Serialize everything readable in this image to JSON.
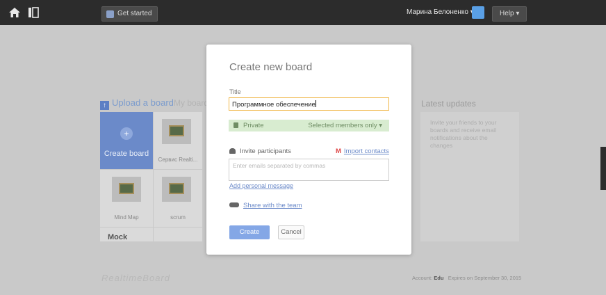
{
  "topbar": {
    "get_started": "Get started",
    "user_name": "Марина Белоненко ▾",
    "help": "Help ▾",
    "icons": [
      "home-icon",
      "layout-toggle-icon",
      "check-icon",
      "avatar"
    ]
  },
  "dashboard": {
    "upload_label": "Upload a board",
    "my_boards_label": "My board",
    "create_board": "Create board",
    "boards": [
      {
        "caption": "Сервис Realti..."
      },
      {
        "caption": "Mind Map"
      },
      {
        "caption": "scrum"
      }
    ],
    "mock_label": "Mock",
    "latest_title": "Latest updates",
    "latest_text": "Invite your friends to your boards and receive email notifications about the changes"
  },
  "footer": {
    "logo": "RealtimeBoard",
    "account_prefix": "Account:",
    "account_name": "Edu",
    "expires": "Expires on September 30, 2015"
  },
  "modal": {
    "title": "Create new board",
    "title_label": "Title",
    "title_value": "Программное обеспечение",
    "privacy": "Private",
    "privacy_option": "Selected members only ▾",
    "invite_label": "Invite participants",
    "import_contacts": "Import contacts",
    "emails_placeholder": "Enter emails separated by commas",
    "add_message": "Add personal message",
    "share_team": "Share with the team",
    "create_btn": "Create",
    "cancel_btn": "Cancel"
  },
  "colors": {
    "topbar": "#2c2c2c",
    "accent": "#6b8ac9",
    "input_focus": "#f0b544",
    "private_bg": "#d8ecd0"
  }
}
